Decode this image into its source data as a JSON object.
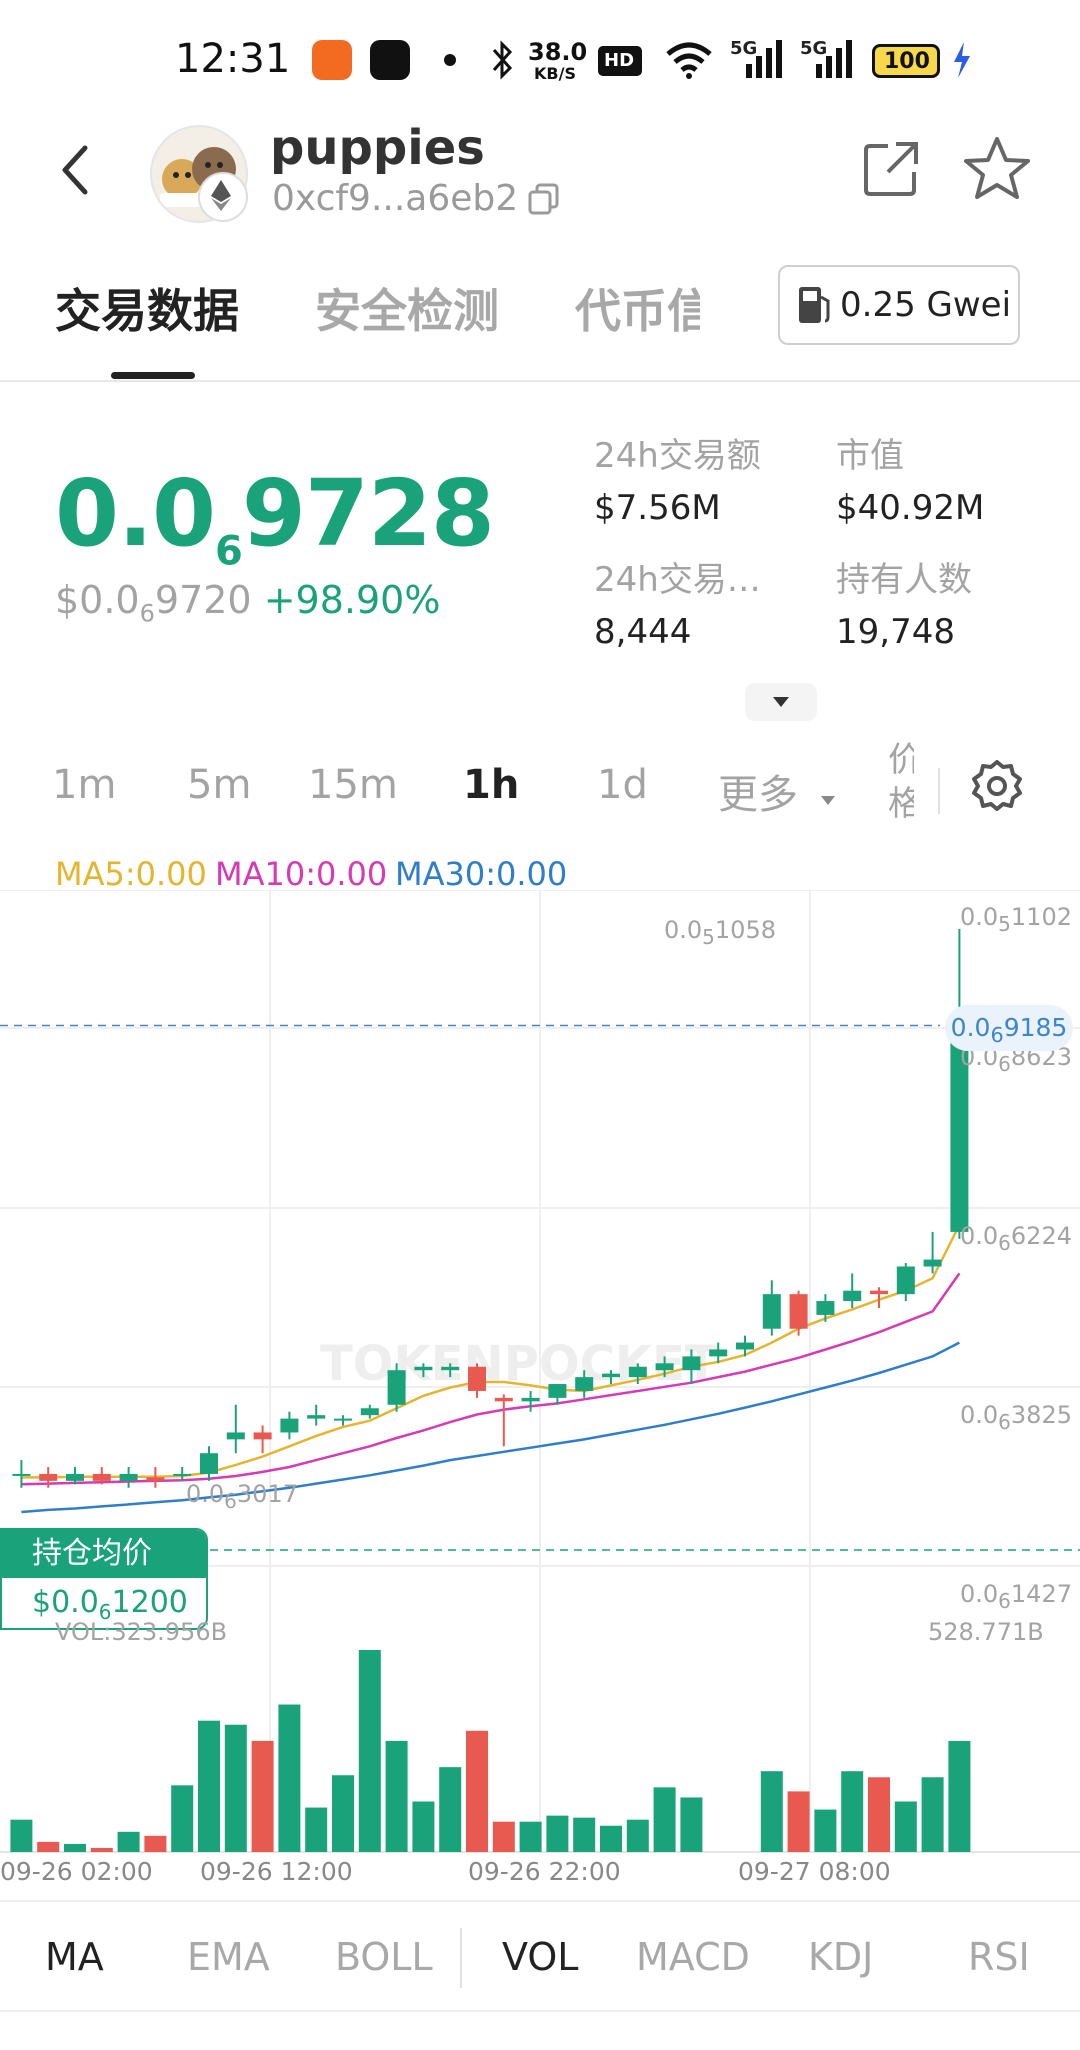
{
  "status_bar": {
    "time": "12:31",
    "net_speed_top": "38.0",
    "net_speed_bottom": "KB/S",
    "hd_badge": "HD",
    "sig1": "5G",
    "sig2": "5G",
    "battery": "100"
  },
  "header": {
    "token_name": "puppies",
    "address": "0xcf9...a6eb2",
    "icons": [
      "back-arrow-icon",
      "ethereum-icon",
      "copy-icon",
      "share-icon",
      "star-icon"
    ]
  },
  "tabs": [
    "交易数据",
    "安全检测",
    "代币信"
  ],
  "gas": {
    "label": "0.25 Gwei"
  },
  "price": {
    "main_prefix": "0.0",
    "main_sub": "6",
    "main_suffix": "9728",
    "usd_prefix": "$0.0",
    "usd_sub": "6",
    "usd_suffix": "9720",
    "change": "+98.90%"
  },
  "stats": [
    {
      "label": "24h交易额",
      "value": "$7.56M"
    },
    {
      "label": "市值",
      "value": "$40.92M"
    },
    {
      "label": "24h交易…",
      "value": "8,444"
    },
    {
      "label": "持有人数",
      "value": "19,748"
    }
  ],
  "intervals": [
    {
      "label": "1m",
      "active": false
    },
    {
      "label": "5m",
      "active": false
    },
    {
      "label": "15m",
      "active": false
    },
    {
      "label": "1h",
      "active": true
    },
    {
      "label": "1d",
      "active": false
    },
    {
      "label": "更多",
      "active": false
    }
  ],
  "interval_cut_label": "价格",
  "ma_legend": {
    "ma5": "MA5:0.00",
    "ma10": "MA10:0.00",
    "ma30": "MA30:0.00"
  },
  "colors": {
    "up": "#1aa37a",
    "down": "#e8594f",
    "ma5": "#e6b530",
    "ma10": "#d63bb5",
    "ma30": "#2f7ecb",
    "accent_blue": "#3e86c8"
  },
  "chart_data": {
    "type": "candlestick",
    "price_axis_labels": [
      {
        "prefix": "0.0",
        "sub": "5",
        "suffix": "1102"
      },
      {
        "prefix": "0.0",
        "sub": "6",
        "suffix": "8623"
      },
      {
        "prefix": "0.0",
        "sub": "6",
        "suffix": "6224"
      },
      {
        "prefix": "0.0",
        "sub": "6",
        "suffix": "3825"
      },
      {
        "prefix": "0.0",
        "sub": "6",
        "suffix": "1427"
      }
    ],
    "current_price_tag": {
      "prefix": "0.0",
      "sub": "6",
      "suffix": "9185"
    },
    "high_annotation": {
      "prefix": "0.0",
      "sub": "5",
      "suffix": "1058"
    },
    "low_annotation": {
      "prefix": "0.0",
      "sub": "6",
      "suffix": "3017"
    },
    "avg_cost": {
      "label": "持仓均价",
      "prefix": "$0.0",
      "sub": "6",
      "suffix": "1200"
    },
    "vol_label": "VOL:323.956B",
    "vol_max_label": "528.771B",
    "time_labels": [
      "09-26 02:00",
      "09-26 12:00",
      "09-26 22:00",
      "09-27 08:00"
    ],
    "candles": [
      {
        "o": 0.27,
        "c": 0.27,
        "h": 0.29,
        "l": 0.25
      },
      {
        "o": 0.27,
        "c": 0.26,
        "h": 0.28,
        "l": 0.25
      },
      {
        "o": 0.26,
        "c": 0.27,
        "h": 0.28,
        "l": 0.255
      },
      {
        "o": 0.27,
        "c": 0.26,
        "h": 0.28,
        "l": 0.255
      },
      {
        "o": 0.26,
        "c": 0.27,
        "h": 0.28,
        "l": 0.25
      },
      {
        "o": 0.265,
        "c": 0.26,
        "h": 0.28,
        "l": 0.25
      },
      {
        "o": 0.27,
        "c": 0.27,
        "h": 0.28,
        "l": 0.26
      },
      {
        "o": 0.27,
        "c": 0.3,
        "h": 0.31,
        "l": 0.26
      },
      {
        "o": 0.32,
        "c": 0.33,
        "h": 0.37,
        "l": 0.3
      },
      {
        "o": 0.33,
        "c": 0.32,
        "h": 0.34,
        "l": 0.3
      },
      {
        "o": 0.33,
        "c": 0.35,
        "h": 0.36,
        "l": 0.32
      },
      {
        "o": 0.35,
        "c": 0.355,
        "h": 0.37,
        "l": 0.34
      },
      {
        "o": 0.35,
        "c": 0.35,
        "h": 0.355,
        "l": 0.34
      },
      {
        "o": 0.355,
        "c": 0.365,
        "h": 0.37,
        "l": 0.35
      },
      {
        "o": 0.37,
        "c": 0.42,
        "h": 0.43,
        "l": 0.36
      },
      {
        "o": 0.42,
        "c": 0.425,
        "h": 0.43,
        "l": 0.41
      },
      {
        "o": 0.42,
        "c": 0.425,
        "h": 0.43,
        "l": 0.41
      },
      {
        "o": 0.425,
        "c": 0.39,
        "h": 0.43,
        "l": 0.38
      },
      {
        "o": 0.38,
        "c": 0.375,
        "h": 0.385,
        "l": 0.31
      },
      {
        "o": 0.375,
        "c": 0.38,
        "h": 0.39,
        "l": 0.36
      },
      {
        "o": 0.38,
        "c": 0.4,
        "h": 0.4,
        "l": 0.37
      },
      {
        "o": 0.39,
        "c": 0.41,
        "h": 0.42,
        "l": 0.38
      },
      {
        "o": 0.41,
        "c": 0.415,
        "h": 0.42,
        "l": 0.4
      },
      {
        "o": 0.41,
        "c": 0.425,
        "h": 0.43,
        "l": 0.4
      },
      {
        "o": 0.42,
        "c": 0.43,
        "h": 0.44,
        "l": 0.41
      },
      {
        "o": 0.42,
        "c": 0.44,
        "h": 0.45,
        "l": 0.4
      },
      {
        "o": 0.44,
        "c": 0.45,
        "h": 0.46,
        "l": 0.43
      },
      {
        "o": 0.45,
        "c": 0.46,
        "h": 0.47,
        "l": 0.44
      },
      {
        "o": 0.48,
        "c": 0.53,
        "h": 0.55,
        "l": 0.47
      },
      {
        "o": 0.53,
        "c": 0.48,
        "h": 0.535,
        "l": 0.47
      },
      {
        "o": 0.5,
        "c": 0.52,
        "h": 0.53,
        "l": 0.49
      },
      {
        "o": 0.52,
        "c": 0.535,
        "h": 0.56,
        "l": 0.51
      },
      {
        "o": 0.535,
        "c": 0.53,
        "h": 0.54,
        "l": 0.51
      },
      {
        "o": 0.53,
        "c": 0.57,
        "h": 0.575,
        "l": 0.52
      },
      {
        "o": 0.57,
        "c": 0.58,
        "h": 0.62,
        "l": 0.56
      },
      {
        "o": 0.62,
        "c": 0.9185,
        "h": 1.058,
        "l": 0.61
      }
    ],
    "ma5": [
      0.265,
      0.265,
      0.266,
      0.266,
      0.266,
      0.266,
      0.267,
      0.272,
      0.283,
      0.295,
      0.31,
      0.325,
      0.338,
      0.347,
      0.365,
      0.383,
      0.395,
      0.403,
      0.403,
      0.398,
      0.392,
      0.39,
      0.398,
      0.406,
      0.415,
      0.425,
      0.432,
      0.442,
      0.46,
      0.48,
      0.495,
      0.508,
      0.522,
      0.535,
      0.553,
      0.63
    ],
    "ma10": [
      0.255,
      0.256,
      0.257,
      0.258,
      0.259,
      0.26,
      0.261,
      0.263,
      0.267,
      0.273,
      0.28,
      0.29,
      0.3,
      0.31,
      0.322,
      0.333,
      0.345,
      0.356,
      0.363,
      0.368,
      0.372,
      0.378,
      0.384,
      0.39,
      0.396,
      0.402,
      0.41,
      0.418,
      0.428,
      0.438,
      0.45,
      0.462,
      0.475,
      0.49,
      0.505,
      0.56
    ],
    "ma30": [
      0.215,
      0.218,
      0.22,
      0.223,
      0.226,
      0.229,
      0.232,
      0.236,
      0.24,
      0.245,
      0.25,
      0.256,
      0.262,
      0.268,
      0.275,
      0.282,
      0.29,
      0.296,
      0.302,
      0.308,
      0.314,
      0.32,
      0.327,
      0.334,
      0.341,
      0.349,
      0.357,
      0.366,
      0.375,
      0.385,
      0.395,
      0.405,
      0.416,
      0.428,
      0.44,
      0.46
    ],
    "volume": [
      0.16,
      0.05,
      0.04,
      0.02,
      0.1,
      0.08,
      0.33,
      0.65,
      0.63,
      0.55,
      0.73,
      0.22,
      0.38,
      1.0,
      0.55,
      0.25,
      0.42,
      0.6,
      0.15,
      0.15,
      0.18,
      0.17,
      0.13,
      0.16,
      0.32,
      0.27,
      0.0,
      0.0,
      0.4,
      0.3,
      0.21,
      0.4,
      0.37,
      0.25,
      0.37,
      0.55
    ]
  },
  "bottom_tabs": [
    {
      "label": "MA",
      "active": true
    },
    {
      "label": "EMA",
      "active": false
    },
    {
      "label": "BOLL",
      "active": false
    },
    {
      "label": "VOL",
      "active": true
    },
    {
      "label": "MACD",
      "active": false
    },
    {
      "label": "KDJ",
      "active": false
    },
    {
      "label": "RSI",
      "active": false
    }
  ]
}
